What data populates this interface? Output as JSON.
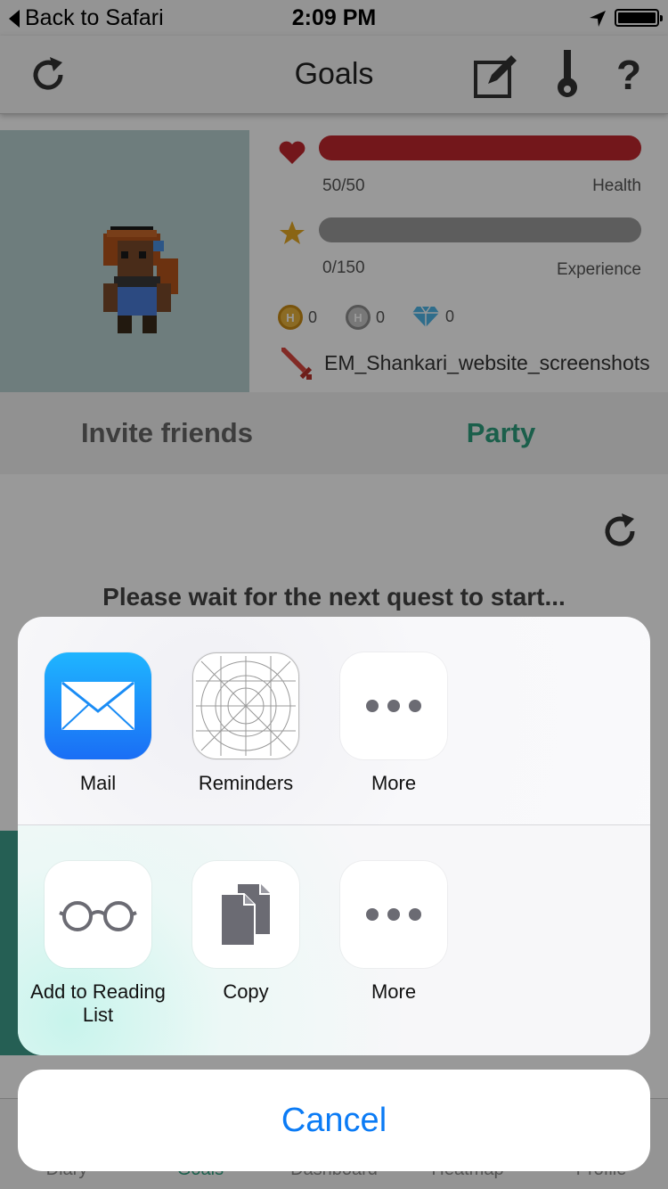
{
  "status_bar": {
    "back_label": "Back to Safari",
    "time": "2:09 PM"
  },
  "navbar": {
    "title": "Goals"
  },
  "profile": {
    "health": {
      "value_text": "50/50",
      "label": "Health",
      "fraction": 1.0,
      "color": "#c0272d"
    },
    "experience": {
      "value_text": "0/150",
      "label": "Experience",
      "fraction": 0.0,
      "color": "#9b9b9b"
    },
    "currencies": [
      {
        "icon": "gold-coin-icon",
        "amount": "0"
      },
      {
        "icon": "silver-coin-icon",
        "amount": "0"
      },
      {
        "icon": "gem-icon",
        "amount": "0"
      }
    ],
    "character_name": "EM_Shankari_website_screenshots"
  },
  "tabs": [
    {
      "label": "Invite friends",
      "active": false
    },
    {
      "label": "Party",
      "active": true
    }
  ],
  "party": {
    "message": "Please wait for the next quest to start..."
  },
  "tabbar": [
    "Diary",
    "Goals",
    "Dashboard",
    "Heatmap",
    "Profile"
  ],
  "share_sheet": {
    "row1": [
      {
        "label": "Mail",
        "icon": "mail-icon"
      },
      {
        "label": "Reminders",
        "icon": "reminders-icon"
      },
      {
        "label": "More",
        "icon": "more-icon"
      }
    ],
    "row2": [
      {
        "label": "Add to Reading List",
        "icon": "glasses-icon"
      },
      {
        "label": "Copy",
        "icon": "copy-icon"
      },
      {
        "label": "More",
        "icon": "more-icon"
      }
    ],
    "cancel_label": "Cancel"
  },
  "colors": {
    "accent": "#2d9e7e",
    "ios_blue": "#0b7bf5",
    "health_red": "#c0272d"
  }
}
